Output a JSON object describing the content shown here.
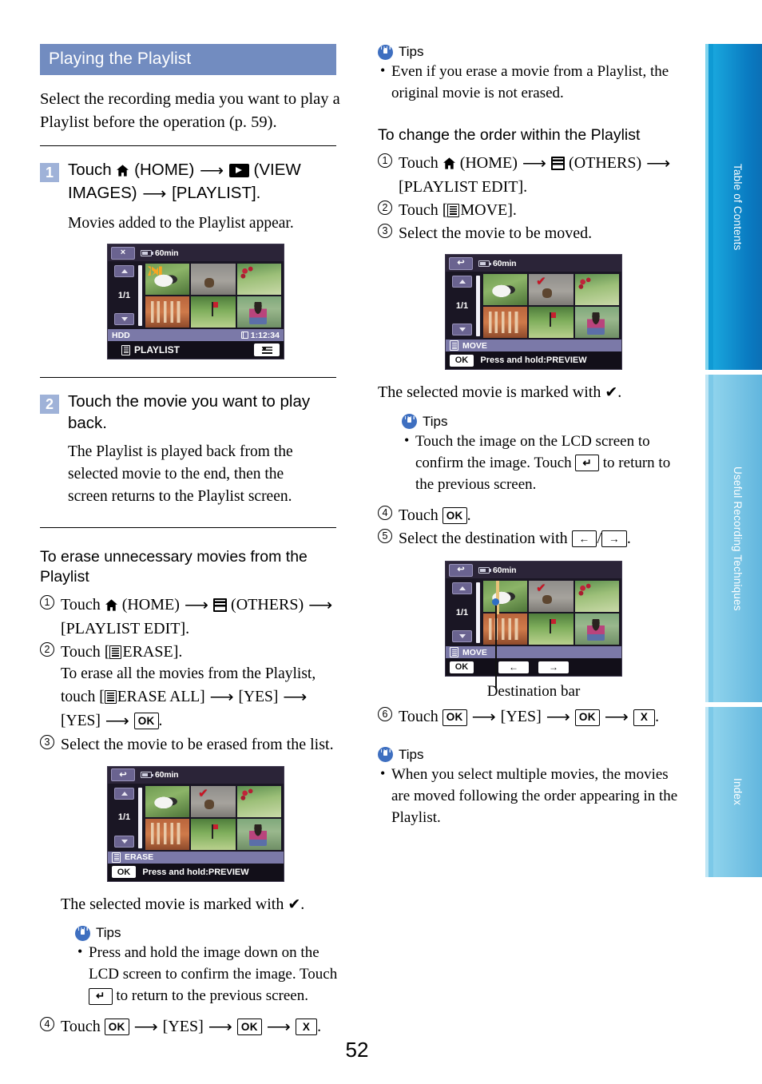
{
  "page": {
    "number": "52"
  },
  "section": {
    "title": "Playing the Playlist",
    "lead": "Select the recording media you want to play a Playlist before the operation (p. 59)."
  },
  "steps": [
    {
      "num": "1",
      "title_pre": "Touch",
      "home_label": "(HOME)",
      "view_label": "(VIEW IMAGES)",
      "target": "[PLAYLIST].",
      "sub": "Movies added to the Playlist appear."
    },
    {
      "num": "2",
      "title": "Touch the movie you want to play back.",
      "sub": "The Playlist is played back from the selected movie to the end, then the screen returns to the Playlist screen."
    }
  ],
  "erase_section": {
    "heading": "To erase unnecessary movies from the Playlist",
    "item1_pre": "Touch",
    "item1_home": "(HOME)",
    "item1_others": "(OTHERS)",
    "item1_target": "[PLAYLIST EDIT].",
    "item2_pre": "Touch [",
    "item2_label": "ERASE].",
    "item2_sub_a": "To erase all the movies from the Playlist, touch [",
    "item2_sub_b": "ERASE ALL]",
    "item2_sub_yes1": "[YES]",
    "item2_sub_yes2": "[YES]",
    "item2_sub_ok": "OK",
    "item3": "Select the movie to be erased from the list.",
    "after_caption_a": "The selected movie is marked with",
    "after_caption_b": ".",
    "tips_label": "Tips",
    "tip_bullet": "Press and hold the image down on the LCD screen to confirm the image. Touch",
    "tip_bullet_tail": "to return to the previous screen.",
    "item4_pre": "Touch",
    "item4_ok1": "OK",
    "item4_yes": "[YES]",
    "item4_ok2": "OK",
    "item4_x": "X"
  },
  "right_tips_top": {
    "label": "Tips",
    "bullet": "Even if you erase a movie from a Playlist, the original movie is not erased."
  },
  "order_section": {
    "heading": "To change the order within the Playlist",
    "item1_pre": "Touch",
    "item1_home": "(HOME)",
    "item1_others": "(OTHERS)",
    "item1_target": "[PLAYLIST EDIT].",
    "item2_pre": "Touch [",
    "item2_label": "MOVE].",
    "item3": "Select the movie to be moved.",
    "after_caption_a": "The selected movie is marked with",
    "after_caption_b": ".",
    "tips_label": "Tips",
    "tip_bullet": "Touch the image on the LCD screen to confirm the image. Touch",
    "tip_bullet_tail": "to return to the previous screen.",
    "item4_pre": "Touch",
    "item4_ok": "OK",
    "item5_pre": "Select the destination with",
    "item5_left": "←",
    "item5_right": "→",
    "destination_caption": "Destination bar",
    "item6_pre": "Touch",
    "item6_ok1": "OK",
    "item6_yes": "[YES]",
    "item6_ok2": "OK",
    "item6_x": "X"
  },
  "right_tips_bottom": {
    "label": "Tips",
    "bullet": "When you select multiple movies, the movies are moved following the order appearing in the Playlist."
  },
  "lcd_screens": {
    "playlist": {
      "top_button": "×",
      "battery": "60min",
      "page_indicator": "1/1",
      "media": "HDD",
      "duration": "1:12:34",
      "label": "PLAYLIST"
    },
    "erase": {
      "top_button": "↩",
      "battery": "60min",
      "page_indicator": "1/1",
      "mode_label": "ERASE",
      "ok": "OK",
      "hint": "Press and hold:PREVIEW"
    },
    "move_select": {
      "top_button": "↩",
      "battery": "60min",
      "page_indicator": "1/1",
      "mode_label": "MOVE",
      "ok": "OK",
      "hint": "Press and hold:PREVIEW"
    },
    "move_destination": {
      "top_button": "↩",
      "battery": "60min",
      "page_indicator": "1/1",
      "mode_label": "MOVE",
      "ok": "OK",
      "left_arrow": "←",
      "right_arrow": "→"
    }
  },
  "sidebar": {
    "tabs": [
      {
        "label": "Table of Contents",
        "color": "#0a7cc2"
      },
      {
        "label": "Useful Recording Techniques",
        "color": "#7cc9e8"
      },
      {
        "label": "Index",
        "color": "#7cc9e8"
      }
    ]
  }
}
